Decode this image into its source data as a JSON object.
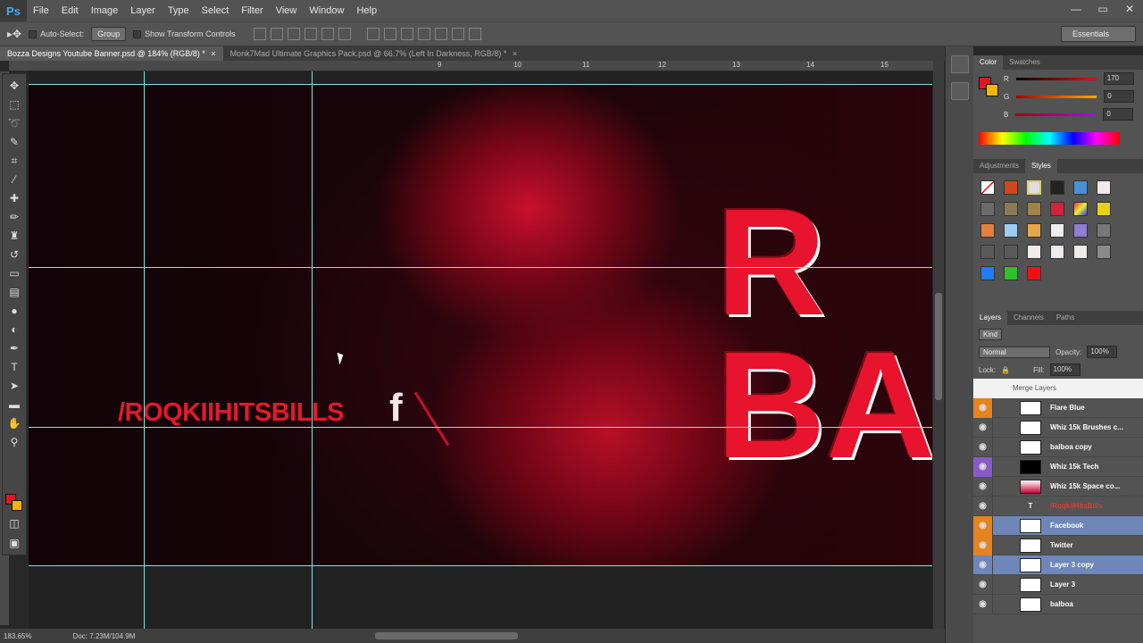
{
  "app": {
    "logo": "Ps"
  },
  "menu": [
    "File",
    "Edit",
    "Image",
    "Layer",
    "Type",
    "Select",
    "Filter",
    "View",
    "Window",
    "Help"
  ],
  "window_controls": {
    "minimize": "—",
    "restore": "▭",
    "close": "✕"
  },
  "options_bar": {
    "auto_select": "Auto-Select:",
    "auto_select_target": "Group",
    "show_transform": "Show Transform Controls",
    "workspace": "Essentials"
  },
  "tabs": [
    {
      "label": "Bozza Designs Youtube Banner.psd @ 184% (RGB/8) *",
      "close": "×"
    },
    {
      "label": "Monk7Mad Ultimate Graphics Pack.psd @ 66.7% (Left In Darkness, RGB/8) *",
      "close": "×"
    }
  ],
  "ruler_ticks": [
    "9",
    "10",
    "11",
    "12",
    "13",
    "14",
    "15"
  ],
  "canvas": {
    "channel_name": "/ROQKIIHITSBILLS",
    "social_glyph": "f",
    "big_title": "R\nBA"
  },
  "status": {
    "zoom": "183.65%",
    "doc": "Doc: 7.23M/104.9M"
  },
  "color_panel": {
    "tabs": [
      "Color",
      "Swatches"
    ],
    "channels": [
      {
        "name": "R",
        "value": "170"
      },
      {
        "name": "G",
        "value": "0"
      },
      {
        "name": "B",
        "value": "0"
      }
    ]
  },
  "styles_panel": {
    "tabs": [
      "Adjustments",
      "Styles"
    ]
  },
  "layers_panel": {
    "tabs": [
      "Layers",
      "Channels",
      "Paths"
    ],
    "kind": "Kind",
    "blend_mode": "Normal",
    "opacity_label": "Opacity:",
    "opacity": "100%",
    "lock_label": "Lock:",
    "fill_label": "Fill:",
    "fill": "100%",
    "tooltip": "Merge Layers",
    "layers": [
      {
        "name": "Flare Blue",
        "eye": "orange",
        "selected": false
      },
      {
        "name": "Whiz 15k Brushes c...",
        "eye": "normal",
        "selected": false
      },
      {
        "name": "balboa copy",
        "eye": "normal",
        "selected": false
      },
      {
        "name": "Whiz 15k Tech",
        "eye": "purple",
        "selected": false
      },
      {
        "name": "Whiz 15k Space co...",
        "eye": "normal",
        "selected": false
      },
      {
        "name": "/RoqkiiHitsBills",
        "eye": "normal",
        "selected": false,
        "type": "T"
      },
      {
        "name": "Facebook",
        "eye": "orange",
        "selected": true
      },
      {
        "name": "Twitter",
        "eye": "orange",
        "selected": false
      },
      {
        "name": "Layer 3 copy",
        "eye": "normal",
        "selected": true
      },
      {
        "name": "Layer 3",
        "eye": "normal",
        "selected": false
      },
      {
        "name": "balboa",
        "eye": "normal",
        "selected": false
      }
    ]
  },
  "colors": {
    "foreground": "#e8131c",
    "background": "#f5b400",
    "guide": "#7fe5e0",
    "accent_red": "#e11a2e"
  }
}
